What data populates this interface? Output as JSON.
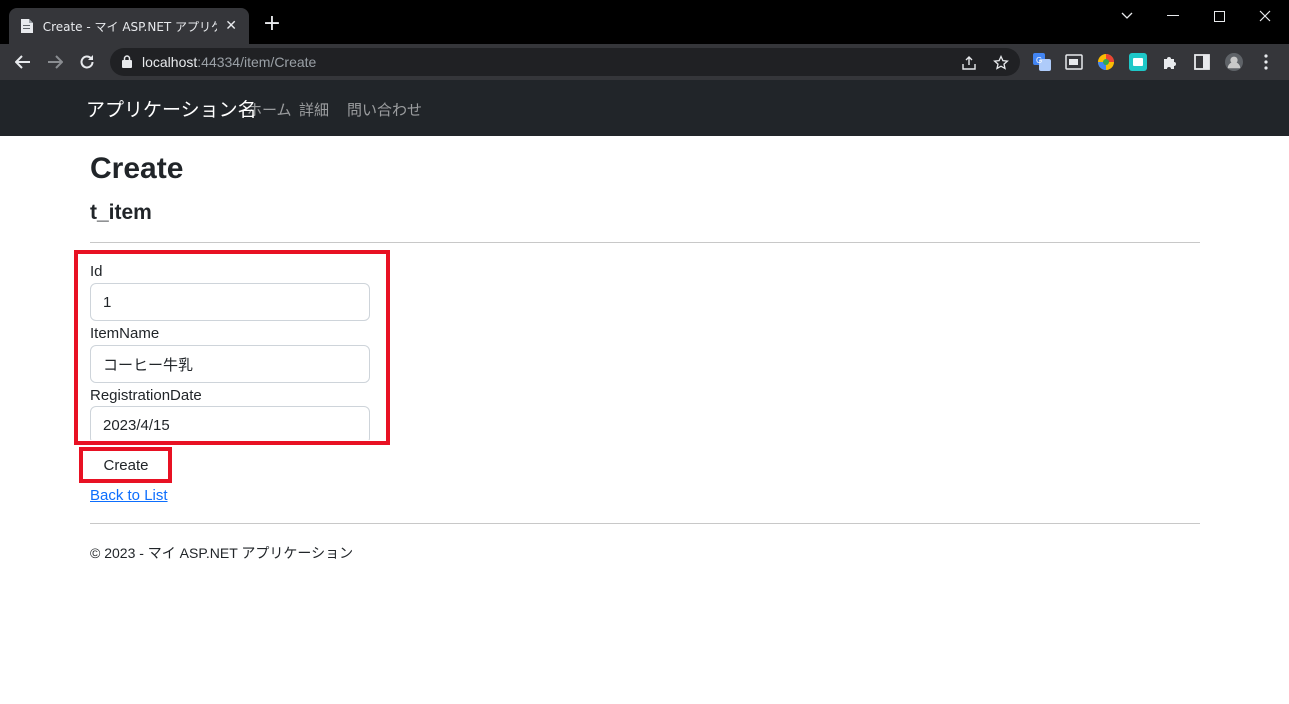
{
  "browser": {
    "tab_title": "Create - マイ ASP.NET アプリケーション",
    "url_host": "localhost",
    "url_path": ":44334/item/Create"
  },
  "site": {
    "brand": "アプリケーション名",
    "nav": [
      "ホーム",
      "詳細",
      "問い合わせ"
    ]
  },
  "page": {
    "title": "Create",
    "subtitle": "t_item",
    "fields": [
      {
        "label": "Id",
        "value": "1"
      },
      {
        "label": "ItemName",
        "value": "コーヒー牛乳"
      },
      {
        "label": "RegistrationDate",
        "value": "2023/4/15"
      }
    ],
    "submit_label": "Create",
    "back_link": "Back to List",
    "footer": "© 2023 - マイ ASP.NET アプリケーション"
  },
  "colors": {
    "highlight": "#e81123",
    "navbar": "#212529",
    "link": "#0d6efd"
  }
}
